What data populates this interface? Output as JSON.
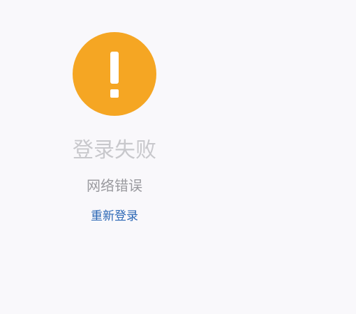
{
  "status": {
    "icon": "exclamation-icon",
    "icon_color": "#f5a623",
    "title": "登录失败",
    "message": "网络错误",
    "action_label": "重新登录"
  },
  "colors": {
    "background": "#f9f8fb",
    "title": "#c8c8cc",
    "message": "#9a9a9f",
    "link": "#2b67b5"
  }
}
